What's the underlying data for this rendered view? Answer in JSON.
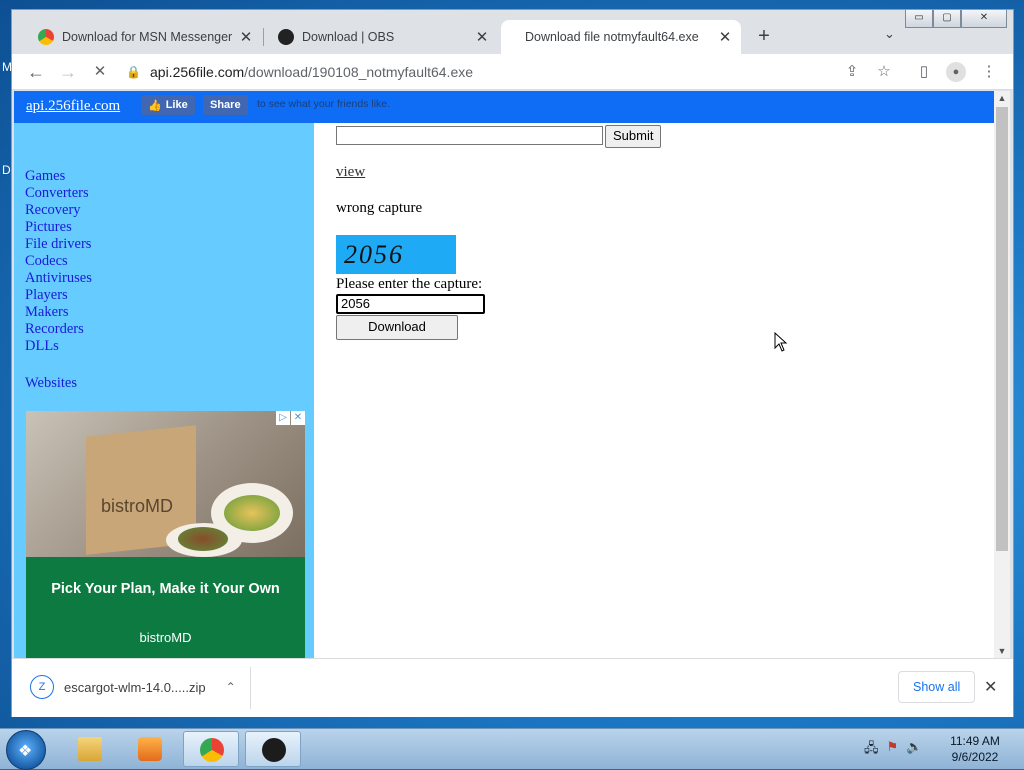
{
  "desktop": {
    "left_label_1": "M",
    "left_label_2": "D"
  },
  "browser": {
    "tabs": [
      {
        "title": "Download for MSN Messenger | ",
        "close": "✕",
        "favicon_color": "#e8ab2c",
        "active": false
      },
      {
        "title": "Download | OBS",
        "close": "✕",
        "favicon_color": "#222222",
        "active": false
      },
      {
        "title": "Download file notmyfault64.exe",
        "close": "✕",
        "favicon_color": "",
        "active": true
      }
    ],
    "new_tab": "+",
    "tab_search": "⌄",
    "window_buttons": {
      "minimize": "▭",
      "maximize": "▢",
      "close": "✕"
    },
    "nav": {
      "back": "←",
      "forward": "→",
      "reload": "✕"
    },
    "url": {
      "host": "api.256file.com",
      "path": "/download/190108_notmyfault64.exe"
    },
    "toolbar_icons": {
      "share": "⇪",
      "bookmark": "☆",
      "sidepanel": "▯",
      "profile": "●",
      "menu": "⋮"
    }
  },
  "page": {
    "site_link": "api.256file.com",
    "fb": {
      "like": "Like",
      "share": "Share",
      "text": "to see what your friends like."
    },
    "categories": [
      "Games",
      "Converters",
      "Recovery",
      "Pictures",
      "File drivers",
      "Codecs",
      "Antiviruses",
      "Players",
      "Makers",
      "Recorders",
      "DLLs"
    ],
    "websites": "Websites",
    "ad": {
      "brand": "bistroMD",
      "headline": "Pick Your Plan, Make it Your Own",
      "logo": "bistroMD",
      "close": "✕",
      "adchoice": "▷"
    },
    "search": {
      "value": "",
      "submit": "Submit"
    },
    "view_link": "view",
    "wrong_capture": "wrong capture",
    "captcha_text": "2056",
    "capture_label": "Please enter the capture:",
    "capture_value": "2056",
    "download_button": "Download"
  },
  "download_shelf": {
    "filename": "escargot-wlm-14.0.....zip",
    "show_all": "Show all",
    "close": "✕",
    "chevron": "⌃"
  },
  "taskbar": {
    "time": "11:49 AM",
    "date": "9/6/2022"
  }
}
